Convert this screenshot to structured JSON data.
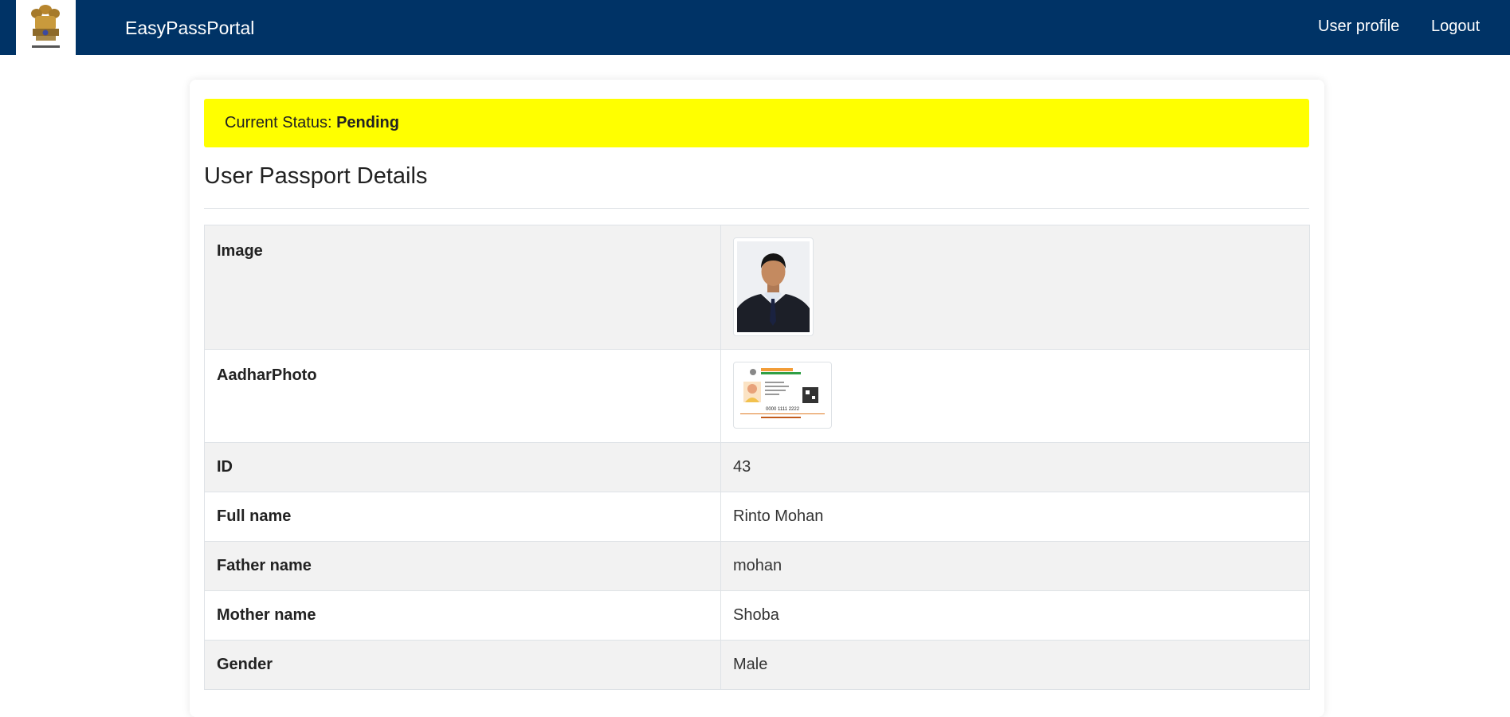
{
  "nav": {
    "brand": "EasyPassPortal",
    "user_profile": "User profile",
    "logout": "Logout"
  },
  "status": {
    "label": "Current Status:",
    "value": "Pending",
    "color": "#ffff00"
  },
  "page_title": "User Passport Details",
  "details": {
    "image_label": "Image",
    "aadhar_label": "AadharPhoto",
    "rows": [
      {
        "label": "ID",
        "value": "43"
      },
      {
        "label": "Full name",
        "value": "Rinto Mohan"
      },
      {
        "label": "Father name",
        "value": "mohan"
      },
      {
        "label": "Mother name",
        "value": "Shoba"
      },
      {
        "label": "Gender",
        "value": "Male"
      }
    ]
  },
  "aadhar_card": {
    "number": "0000 1111 2222"
  },
  "colors": {
    "navbar": "#003366",
    "status_bg": "#ffff00"
  }
}
